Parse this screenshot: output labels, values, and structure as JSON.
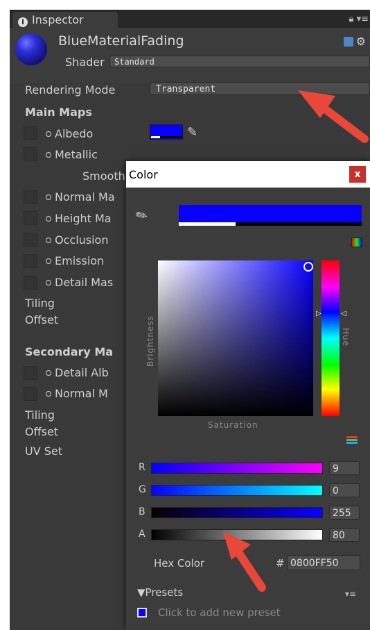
{
  "inspector": {
    "tab_label": "Inspector",
    "material_name": "BlueMaterialFading",
    "shader_label": "Shader",
    "shader_value": "Standard"
  },
  "properties": {
    "rendering_mode_label": "Rendering Mode",
    "rendering_mode_value": "Transparent",
    "main_maps_header": "Main Maps",
    "main_maps": [
      "Albedo",
      "Metallic",
      "Normal Ma",
      "Height Ma",
      "Occlusion",
      "Emission",
      "Detail Mas"
    ],
    "smoothness_label": "Smooth",
    "tiling_label": "Tiling",
    "offset_label": "Offset",
    "secondary_maps_header": "Secondary Ma",
    "secondary_maps": [
      "Detail Alb",
      "Normal M"
    ],
    "tiling2_label": "Tiling",
    "offset2_label": "Offset",
    "uv_set_label": "UV Set"
  },
  "color_picker": {
    "title": "Color",
    "close_label": "x",
    "brightness_label": "Brightness",
    "saturation_label": "Saturation",
    "hue_label": "Hue",
    "channels": [
      {
        "label": "R",
        "value": "9"
      },
      {
        "label": "G",
        "value": "0"
      },
      {
        "label": "B",
        "value": "255"
      },
      {
        "label": "A",
        "value": "80"
      }
    ],
    "hex_label": "Hex Color",
    "hex_hash": "#",
    "hex_value": "0800FF50",
    "presets_label": "Presets",
    "presets_hint": "Click to add new preset"
  },
  "colors": {
    "selected_color": "#0800ff",
    "annotation_arrow": "#e8473a",
    "close_button": "#c9302c"
  }
}
